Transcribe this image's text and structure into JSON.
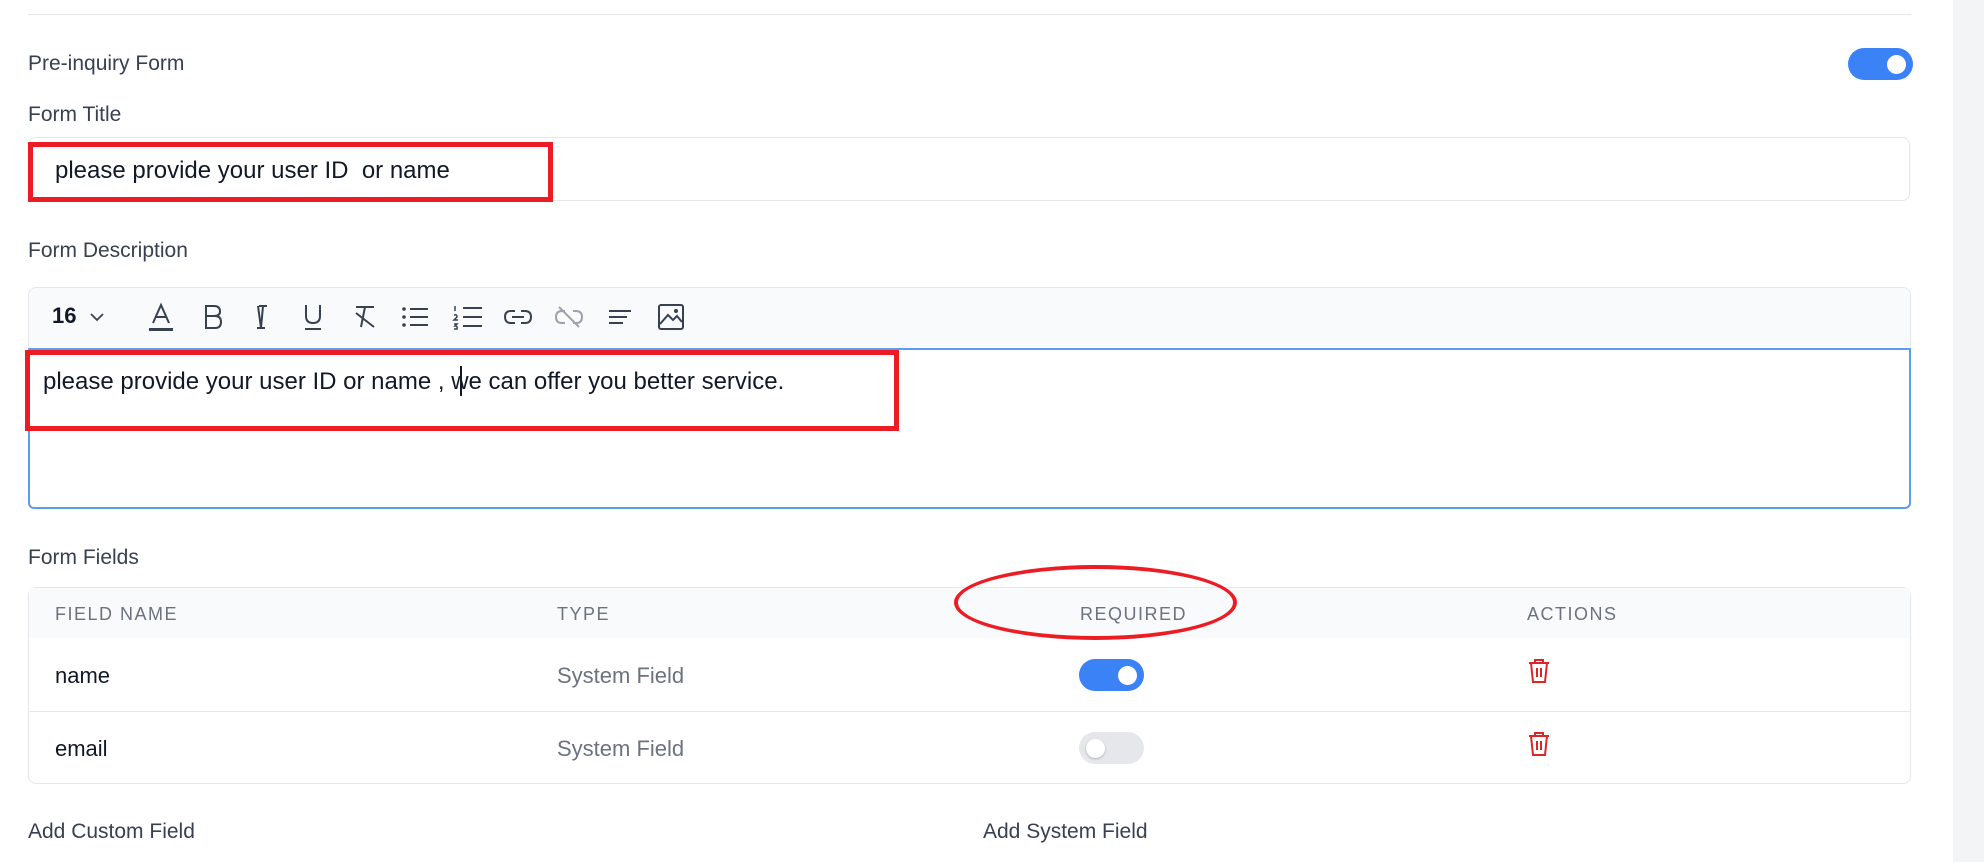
{
  "pre_inquiry": {
    "label": "Pre-inquiry Form",
    "enabled": true
  },
  "form_title": {
    "label": "Form Title",
    "value": "please provide your user ID  or name"
  },
  "form_description": {
    "label": "Form Description",
    "toolbar": {
      "font_size": "16",
      "icons": [
        "font-color-icon",
        "bold-icon",
        "italic-icon",
        "underline-icon",
        "clear-format-icon",
        "bullet-list-icon",
        "numbered-list-icon",
        "link-icon",
        "unlink-icon",
        "align-icon",
        "image-icon"
      ]
    },
    "value": "please provide your user ID or name , we can offer you better service."
  },
  "form_fields": {
    "label": "Form Fields",
    "columns": [
      "FIELD NAME",
      "TYPE",
      "REQUIRED",
      "ACTIONS"
    ],
    "rows": [
      {
        "name": "name",
        "type": "System Field",
        "required": true
      },
      {
        "name": "email",
        "type": "System Field",
        "required": false
      }
    ]
  },
  "add_custom_field": {
    "label": "Add Custom Field"
  },
  "add_system_field": {
    "label": "Add System Field"
  },
  "colors": {
    "accent": "#3b82f6",
    "annotation": "#ec1c24",
    "delete": "#dc2626"
  }
}
